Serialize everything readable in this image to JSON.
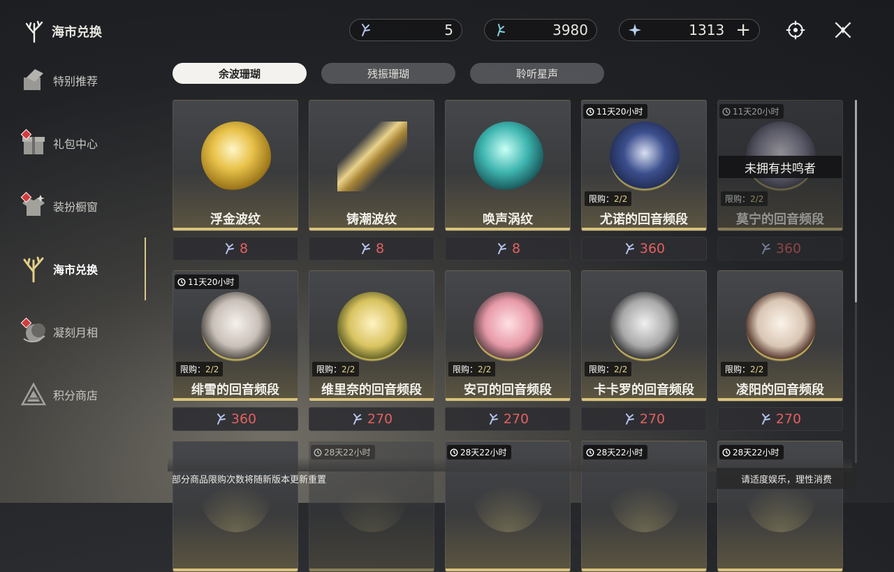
{
  "header": {
    "title": "海市兑换",
    "currencies": [
      {
        "icon": "coral-shard-icon",
        "value": "5"
      },
      {
        "icon": "coral-crystal-icon",
        "value": "3980"
      },
      {
        "icon": "star-crystal-icon",
        "value": "1313"
      }
    ],
    "add_label": "+",
    "actions": [
      "target-settings-icon",
      "close-icon"
    ]
  },
  "sidebar": {
    "items": [
      {
        "label": "特别推荐",
        "icon": "recommend-icon"
      },
      {
        "label": "礼包中心",
        "icon": "gift-icon"
      },
      {
        "label": "装扮橱窗",
        "icon": "outfit-icon"
      },
      {
        "label": "海市兑换",
        "icon": "coral-exchange-icon"
      },
      {
        "label": "凝刻月相",
        "icon": "moon-phase-icon"
      },
      {
        "label": "积分商店",
        "icon": "points-shop-icon"
      }
    ],
    "active_index": 3
  },
  "tabs": [
    {
      "label": "余波珊瑚"
    },
    {
      "label": "残振珊瑚"
    },
    {
      "label": "聆听星声"
    }
  ],
  "limit_prefix": "限购：",
  "products": [
    {
      "name": "浮金波纹",
      "price": "8",
      "timer": "",
      "limit": "",
      "art": "gold",
      "disabled": false
    },
    {
      "name": "铸潮波纹",
      "price": "8",
      "timer": "",
      "limit": "",
      "art": "blade",
      "disabled": false
    },
    {
      "name": "唤声涡纹",
      "price": "8",
      "timer": "",
      "limit": "",
      "art": "teal",
      "disabled": false
    },
    {
      "name": "尤诺的回音频段",
      "price": "360",
      "timer": "11天20小时",
      "limit": "2/2",
      "art": "portrait-blue",
      "disabled": false
    },
    {
      "name": "莫宁的回音频段",
      "price": "360",
      "timer": "11天20小时",
      "limit": "2/2",
      "art": "portrait-silver",
      "disabled": true,
      "overlay": "未拥有共鸣者"
    },
    {
      "name": "绯雪的回音频段",
      "price": "360",
      "timer": "11天20小时",
      "limit": "2/2",
      "art": "portrait-white",
      "disabled": false
    },
    {
      "name": "维里奈的回音频段",
      "price": "270",
      "timer": "",
      "limit": "2/2",
      "art": "portrait-yellow",
      "disabled": false
    },
    {
      "name": "安可的回音频段",
      "price": "270",
      "timer": "",
      "limit": "2/2",
      "art": "portrait-pink",
      "disabled": false
    },
    {
      "name": "卡卡罗的回音频段",
      "price": "270",
      "timer": "",
      "limit": "2/2",
      "art": "portrait-grey",
      "disabled": false
    },
    {
      "name": "凌阳的回音频段",
      "price": "270",
      "timer": "",
      "limit": "2/2",
      "art": "portrait-lion",
      "disabled": false
    },
    {
      "name": "",
      "price": "",
      "timer": "",
      "limit": "",
      "art": "partial",
      "disabled": false
    },
    {
      "name": "",
      "price": "",
      "timer": "28天22小时",
      "limit": "",
      "art": "partial",
      "disabled": true
    },
    {
      "name": "",
      "price": "",
      "timer": "28天22小时",
      "limit": "",
      "art": "partial",
      "disabled": false
    },
    {
      "name": "",
      "price": "",
      "timer": "28天22小时",
      "limit": "",
      "art": "partial",
      "disabled": false
    },
    {
      "name": "",
      "price": "",
      "timer": "28天22小时",
      "limit": "",
      "art": "partial",
      "disabled": false
    }
  ],
  "footer": {
    "note": "部分商品限购次数将随新版本更新重置",
    "advice": "请适度娱乐，理性消费"
  },
  "colors": {
    "accent_gold": "#d9c27a",
    "price_red": "#e36060",
    "tab_active": "#f3f2ee"
  }
}
